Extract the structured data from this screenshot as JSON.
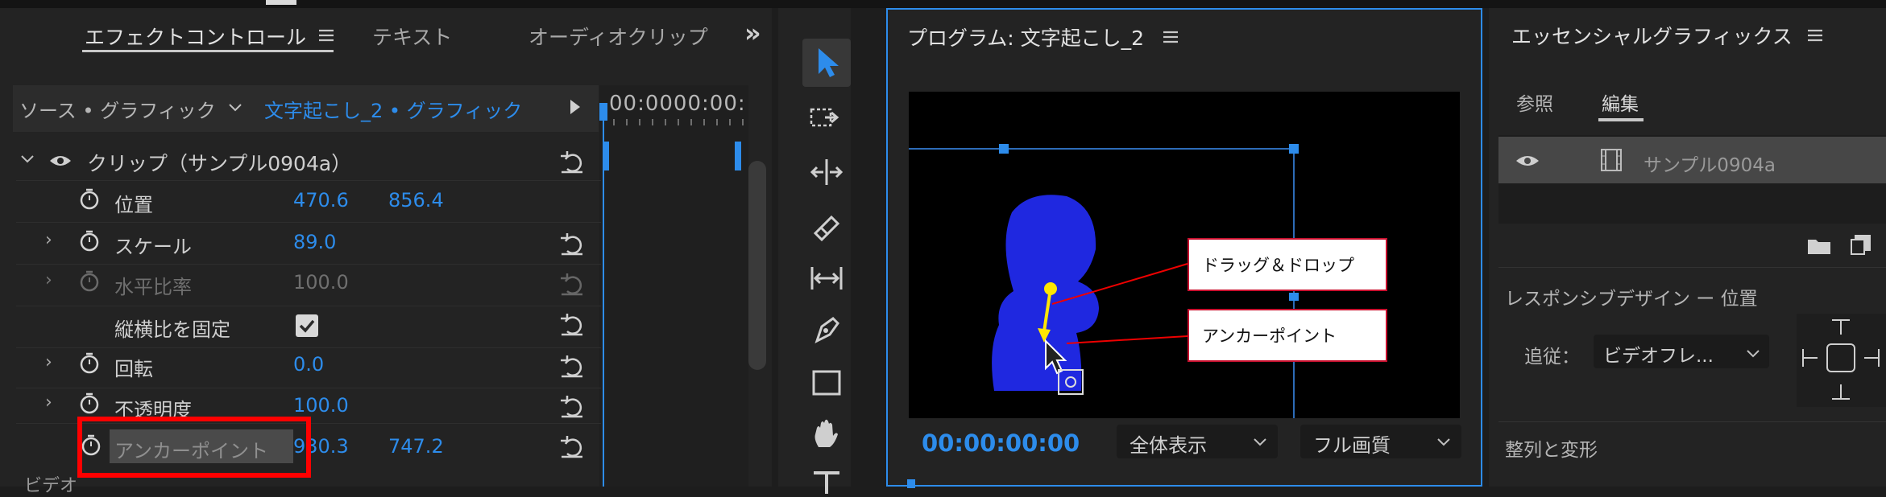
{
  "effect_panel": {
    "tabs": [
      "エフェクトコントロール",
      "テキスト",
      "オーディオクリップ"
    ],
    "more": "»",
    "source_label": "ソース • グラフィック",
    "sequence_label": "文字起こし_2 • グラフィック",
    "timecode": "00:0000:00:",
    "clip_header": "クリップ（サンプル0904a）",
    "props": [
      {
        "name": "位置",
        "v1": "470.6",
        "v2": "856.4"
      },
      {
        "name": "スケール",
        "v1": "89.0",
        "v2": ""
      },
      {
        "name": "水平比率",
        "v1": "100.0",
        "v2": ""
      },
      {
        "name": "縦横比を固定",
        "v1": "",
        "v2": ""
      },
      {
        "name": "回転",
        "v1": "0.0",
        "v2": ""
      },
      {
        "name": "不透明度",
        "v1": "100.0",
        "v2": ""
      },
      {
        "name": "アンカーポイント",
        "v1": "930.3",
        "v2": "747.2"
      }
    ],
    "bottom_label": "ビデオ"
  },
  "program": {
    "title": "プログラム: 文字起こし_2",
    "timecode": "00:00:00:00",
    "zoom": "全体表示",
    "quality": "フル画質",
    "callout_drag": "ドラッグ＆ドロップ",
    "callout_anchor": "アンカーポイント"
  },
  "essential": {
    "title": "エッセンシャルグラフィックス",
    "tab_browse": "参照",
    "tab_edit": "編集",
    "layer_name": "サンプル0904a",
    "responsive_label": "レスポンシブデザイン ー 位置",
    "follow_label": "追従：",
    "follow_value": "ビデオフレ...",
    "align_label": "整列と変形"
  },
  "colors": {
    "accent": "#2d8ceb",
    "highlight": "#ff0000",
    "figure": "#1f28e0"
  }
}
